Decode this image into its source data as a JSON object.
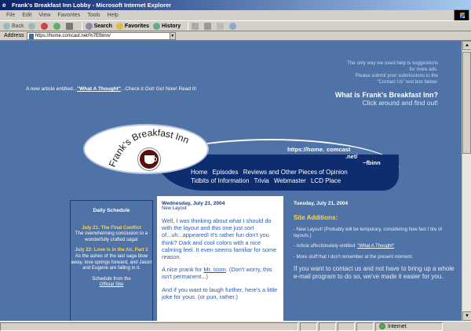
{
  "window": {
    "title": "Frank's Breakfast Inn Lobby - Microsoft Internet Explorer"
  },
  "menu": [
    "File",
    "Edit",
    "View",
    "Favorites",
    "Tools",
    "Help"
  ],
  "toolbar": {
    "back": "Back",
    "search": "Search",
    "favorites": "Favorites",
    "history": "History"
  },
  "address": {
    "label": "Address",
    "url": "https://home.comcast.net/%7Efbinn/"
  },
  "page": {
    "new_article_prefix": "A new article entitled...",
    "new_article_link": "\"What A Thought\"",
    "new_article_suffix": "...Check it Out! Go! Now! Read it!",
    "help_note_1": "The only way we need help is suggestions",
    "help_note_2": "for more ads.",
    "help_note_3": "Please submit your submissions in the",
    "help_note_4": "\"Contact Us\" text box below.",
    "what_is_q": "What is Frank's Breakfast Inn?",
    "what_is_a": "Click around and find out!",
    "logo_text": "Frank's Breakfast Inn",
    "url_parts": [
      "https://home.",
      "comcast",
      ".net/",
      "~fbinn"
    ],
    "nav_row1": [
      "Home",
      "Episodes",
      "Reviews and Other Pieces of Opinion"
    ],
    "nav_row2": [
      "Tidbits of Information",
      "Trivia",
      "Webmaster",
      "LCD Place"
    ]
  },
  "schedule": {
    "heading": "Daily Schedule",
    "e1_date": "July 21: The Final Conflict",
    "e1_desc": "The overwhelming conclusion to a wonderfully crafted saga!",
    "e2_date": "July 22: Love is in the Air, Part 1",
    "e2_desc": "As the ashes of the last saga blow away, love springs forward, and Jason and Eugene are falling in it.",
    "footer_prefix": "Schedule from the",
    "footer_link": "Official Site"
  },
  "middle": {
    "date": "Wednesday, July 21, 2004",
    "subtitle": "New Layout",
    "p1": "Well, I was thinking about what I should do with the layout and this one just sort of...uh...appeared! It's rather fun don't you think? Dark and cool colors with a nice calming feel. It even seems familiar for some reason.",
    "p2_prefix": "A nice prank for",
    "p2_link": "Mr. Isom",
    "p2_suffix": ". (Don't worry, this isn't permanent...)",
    "p3": "And if you want to laugh further, here's a little joke for yous. (or pun, rather.)"
  },
  "right": {
    "date": "Tuesday, July 21, 2004",
    "heading": "Site Additions:",
    "i1": "- New Layout! (Probably will be temporary, considering how fast I tire of layouts.)",
    "i2_prefix": "- Article affectionately entitled:",
    "i2_link": "\"What A Thought\"",
    "i3": "- More stuff that I don't remember at the present moment.",
    "contact": "If you want to contact us and not have to bring up a whole e-mail program to do so, we've made it easier for you."
  },
  "status": {
    "zone": "Internet"
  },
  "colors": {
    "page_bg": "#4f73a6",
    "nav_band": "#0d2d6e",
    "accent_yellow": "#ffd54a"
  }
}
